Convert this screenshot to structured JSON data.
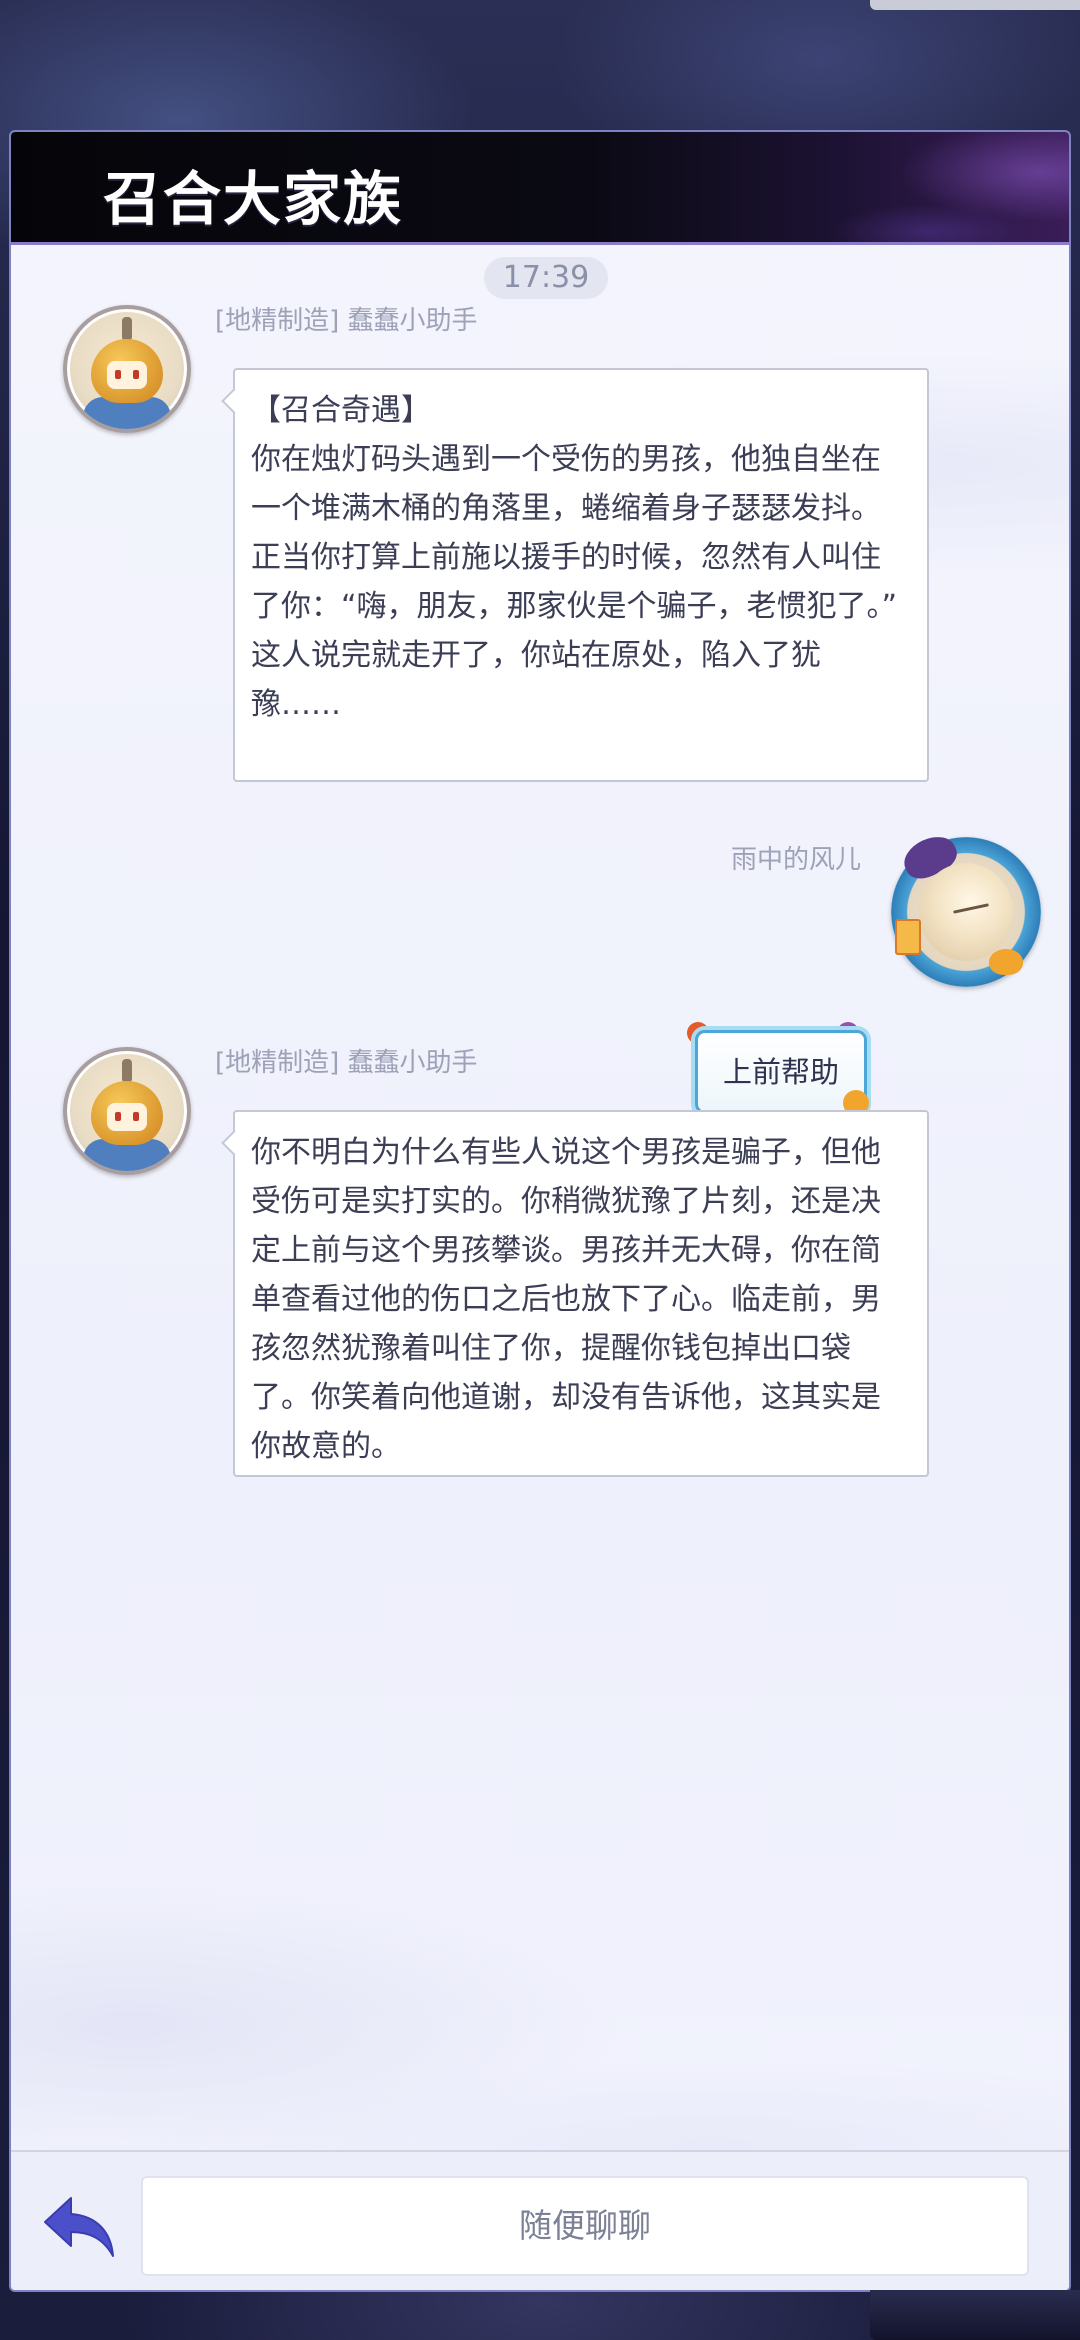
{
  "window": {
    "title": "召合大家族"
  },
  "chat": {
    "timestamp": "17:39",
    "messages": [
      {
        "sender": "[地精制造] 蠢蠢小助手",
        "avatar_icon": "robot-avatar",
        "lines": [
          "【召合奇遇】",
          "你在烛灯码头遇到一个受伤的男孩，他独自坐在一个堆满木桶的角落里，蜷缩着身子瑟瑟发抖。正当你打算上前施以援手的时候，忽然有人叫住了你：“嗨，朋友，那家伙是个骗子，老惯犯了。”",
          "这人说完就走开了，你站在原处，陷入了犹豫……"
        ]
      },
      {
        "sender": "雨中的风儿",
        "avatar_icon": "player-avatar",
        "text": "上前帮助"
      },
      {
        "sender": "[地精制造] 蠢蠢小助手",
        "avatar_icon": "robot-avatar",
        "lines": [
          "你不明白为什么有些人说这个男孩是骗子，但他受伤可是实打实的。你稍微犹豫了片刻，还是决定上前与这个男孩攀谈。男孩并无大碍，你在简单查看过他的伤口之后也放下了心。临走前，男孩忽然犹豫着叫住了你，提醒你钱包掉出口袋了。你笑着向他道谢，却没有告诉他，这其实是你故意的。"
        ]
      }
    ]
  },
  "input": {
    "placeholder": "随便聊聊",
    "back_icon": "back-arrow-icon"
  },
  "colors": {
    "header_bg": "#050509",
    "panel_bg": "#f4f5fd",
    "accent_blue": "#4b4fc9",
    "bubble_border": "#c4c7d6"
  }
}
